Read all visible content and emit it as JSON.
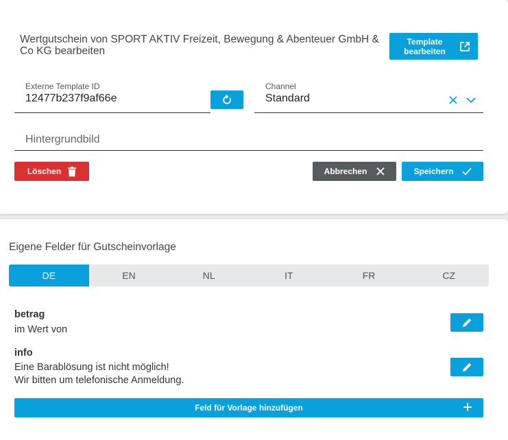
{
  "editor": {
    "title": "Wertgutschein von SPORT AKTIV Freizeit, Bewegung & Abenteuer GmbH & Co KG bearbeiten",
    "template_button_label": "Template bearbeiten",
    "external_id": {
      "label": "Externe Template ID",
      "value": "12477b237f9af66e"
    },
    "channel": {
      "label": "Channel",
      "value": "Standard"
    },
    "background": {
      "placeholder": "Hintergrundbild"
    },
    "delete_label": "Löschen",
    "cancel_label": "Abbrechen",
    "save_label": "Speichern"
  },
  "custom_fields": {
    "title": "Eigene Felder für Gutscheinvorlage",
    "tabs": [
      {
        "label": "DE",
        "active": true
      },
      {
        "label": "EN",
        "active": false
      },
      {
        "label": "NL",
        "active": false
      },
      {
        "label": "IT",
        "active": false
      },
      {
        "label": "FR",
        "active": false
      },
      {
        "label": "CZ",
        "active": false
      }
    ],
    "fields": [
      {
        "name": "betrag",
        "text_1": "im Wert von"
      },
      {
        "name": "info",
        "text_1": "Eine Barablösung ist nicht möglich!",
        "text_2": "Wir bitten um telefonische Anmeldung."
      }
    ],
    "add_label": "Feld für Vorlage hinzufügen"
  },
  "colors": {
    "primary": "#0aa0dc",
    "danger": "#d93131",
    "dark": "#565b5f"
  },
  "icons": [
    "external-link-icon",
    "refresh-icon",
    "close-icon",
    "chevron-down-icon",
    "trash-icon",
    "check-icon",
    "pencil-icon",
    "plus-icon"
  ]
}
